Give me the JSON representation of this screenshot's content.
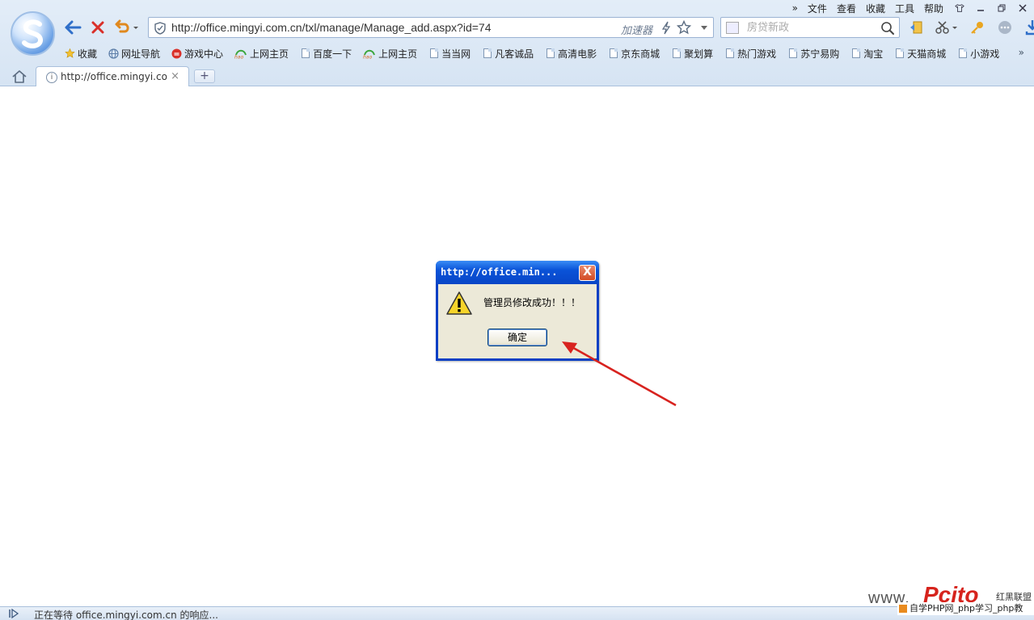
{
  "menu": {
    "more": "»",
    "items": [
      "文件",
      "查看",
      "收藏",
      "工具",
      "帮助"
    ]
  },
  "address_bar": {
    "url": "http://office.mingyi.com.cn/txl/manage/Manage_add.aspx?id=74",
    "accelerator_label": "加速器"
  },
  "search": {
    "placeholder": "房贷新政"
  },
  "bookmarks": [
    {
      "label": "收藏",
      "icon": "star-icon"
    },
    {
      "label": "网址导航",
      "icon": "globe-icon"
    },
    {
      "label": "游戏中心",
      "icon": "game-icon"
    },
    {
      "label": "上网主页",
      "icon": "hao-icon"
    },
    {
      "label": "百度一下",
      "icon": "page-icon"
    },
    {
      "label": "上网主页",
      "icon": "hao-icon"
    },
    {
      "label": "当当网",
      "icon": "page-icon"
    },
    {
      "label": "凡客诚品",
      "icon": "page-icon"
    },
    {
      "label": "高清电影",
      "icon": "page-icon"
    },
    {
      "label": "京东商城",
      "icon": "page-icon"
    },
    {
      "label": "聚划算",
      "icon": "page-icon"
    },
    {
      "label": "热门游戏",
      "icon": "page-icon"
    },
    {
      "label": "苏宁易购",
      "icon": "page-icon"
    },
    {
      "label": "淘宝",
      "icon": "page-icon"
    },
    {
      "label": "天猫商城",
      "icon": "page-icon"
    },
    {
      "label": "小游戏",
      "icon": "page-icon"
    }
  ],
  "bookmarks_more": "»",
  "tab": {
    "title": "http://office.mingyi.com.cn",
    "close": "×",
    "new_tab": "+"
  },
  "dialog": {
    "title": "http://office.min...",
    "close": "X",
    "message": "管理员修改成功！！！",
    "ok_label": "确定"
  },
  "status_bar": {
    "text": "正在等待 office.mingyi.com.cn 的响应..."
  },
  "watermark": {
    "www": "www.",
    "brand": "Pcito",
    "cn": "红黑联盟",
    "strip": "自学PHP网_php学习_php教"
  },
  "colors": {
    "dialog_title_blue": "#0a53d8",
    "arrow_red": "#d8231f",
    "chrome_bg": "#dce8f5"
  }
}
